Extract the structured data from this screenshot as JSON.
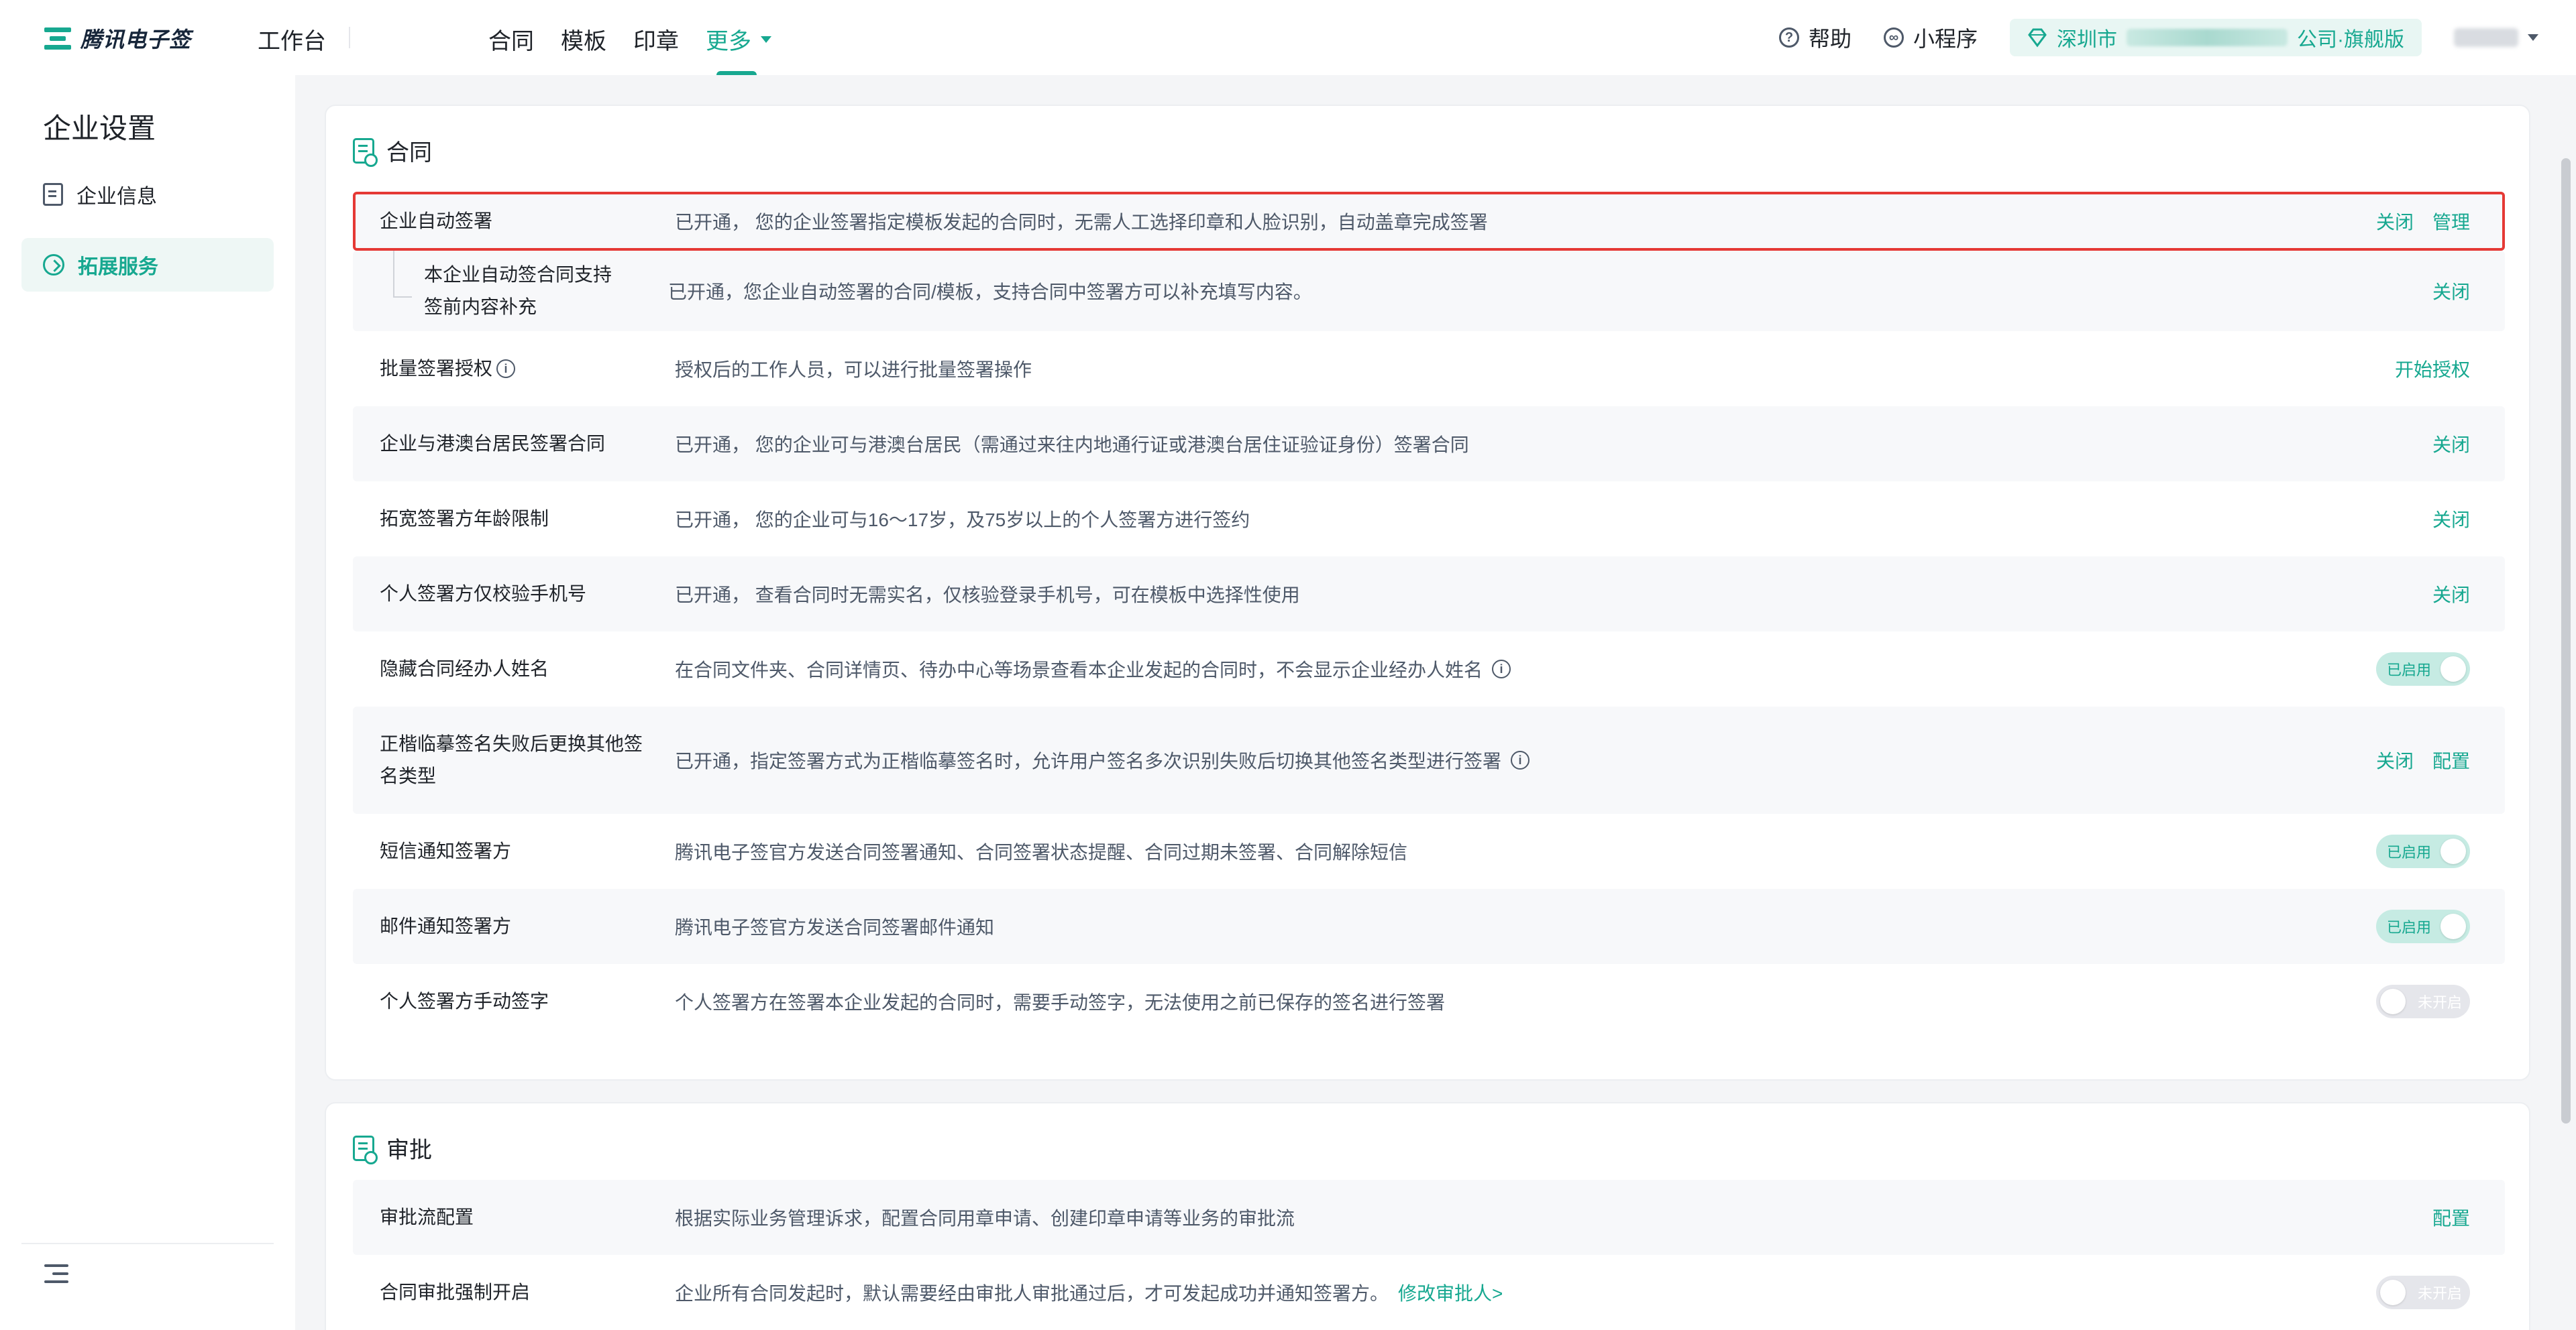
{
  "header": {
    "logo_text": "腾讯电子签",
    "workbench": "工作台",
    "nav": [
      "合同",
      "模板",
      "印章"
    ],
    "more": "更多",
    "help": "帮助",
    "miniprogram": "小程序",
    "company_prefix": "深圳市",
    "company_suffix": "公司·旗舰版"
  },
  "sidebar": {
    "title": "企业设置",
    "items": [
      {
        "label": "企业信息"
      },
      {
        "label": "拓展服务"
      }
    ]
  },
  "contract_section": {
    "title": "合同",
    "rows": [
      {
        "name": "企业自动签署",
        "desc": "已开通， 您的企业签署指定模板发起的合同时，无需人工选择印章和人脸识别，自动盖章完成签署",
        "a1": "关闭",
        "a2": "管理"
      },
      {
        "name": "本企业自动签合同支持签前内容补充",
        "desc": "已开通，您企业自动签署的合同/模板，支持合同中签署方可以补充填写内容。",
        "a1": "关闭"
      },
      {
        "name": "批量签署授权",
        "desc": "授权后的工作人员，可以进行批量签署操作",
        "a1": "开始授权"
      },
      {
        "name": "企业与港澳台居民签署合同",
        "desc": "已开通， 您的企业可与港澳台居民（需通过来往内地通行证或港澳台居住证验证身份）签署合同",
        "a1": "关闭"
      },
      {
        "name": "拓宽签署方年龄限制",
        "desc": "已开通， 您的企业可与16～17岁，及75岁以上的个人签署方进行签约",
        "a1": "关闭"
      },
      {
        "name": "个人签署方仅校验手机号",
        "desc": "已开通， 查看合同时无需实名，仅核验登录手机号，可在模板中选择性使用",
        "a1": "关闭"
      },
      {
        "name": "隐藏合同经办人姓名",
        "desc": "在合同文件夹、合同详情页、待办中心等场景查看本企业发起的合同时，不会显示企业经办人姓名",
        "toggle": "已启用"
      },
      {
        "name": "正楷临摹签名失败后更换其他签名类型",
        "desc": "已开通，指定签署方式为正楷临摹签名时，允许用户签名多次识别失败后切换其他签名类型进行签署",
        "a1": "关闭",
        "a2": "配置"
      },
      {
        "name": "短信通知签署方",
        "desc": "腾讯电子签官方发送合同签署通知、合同签署状态提醒、合同过期未签署、合同解除短信",
        "toggle": "已启用"
      },
      {
        "name": "邮件通知签署方",
        "desc": "腾讯电子签官方发送合同签署邮件通知",
        "toggle": "已启用"
      },
      {
        "name": "个人签署方手动签字",
        "desc": "个人签署方在签署本企业发起的合同时，需要手动签字，无法使用之前已保存的签名进行签署",
        "toggle": "未开启"
      }
    ]
  },
  "approval_section": {
    "title": "审批",
    "rows": [
      {
        "name": "审批流配置",
        "desc": "根据实际业务管理诉求，配置合同用章申请、创建印章申请等业务的审批流",
        "a1": "配置"
      },
      {
        "name": "合同审批强制开启",
        "desc": "企业所有合同发起时，默认需要经由审批人审批通过后，才可发起成功并通知签署方。",
        "link": "修改审批人>",
        "toggle": "未开启"
      }
    ]
  },
  "colors": {
    "accent": "#17a890",
    "highlight": "#e53935"
  }
}
